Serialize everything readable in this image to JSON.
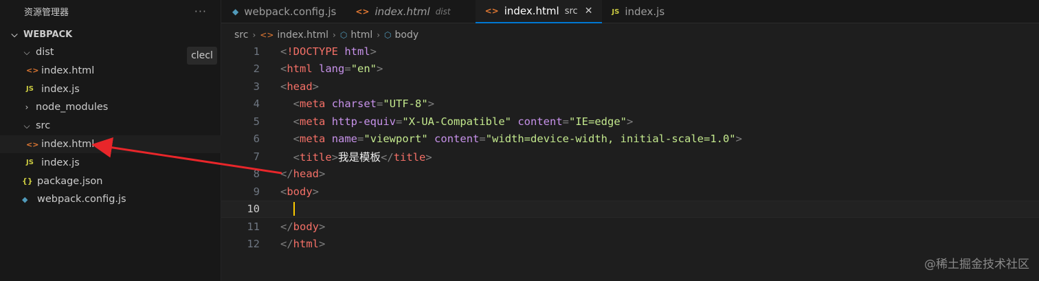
{
  "sidebar": {
    "title": "资源管理器",
    "more": "···",
    "root": "WEBPACK",
    "items": [
      {
        "label": "dist",
        "type": "folder",
        "open": true,
        "depth": 1
      },
      {
        "label": "index.html",
        "type": "html",
        "depth": 2
      },
      {
        "label": "index.js",
        "type": "js",
        "depth": 2
      },
      {
        "label": "node_modules",
        "type": "folder",
        "open": false,
        "depth": 1
      },
      {
        "label": "src",
        "type": "folder",
        "open": true,
        "depth": 1
      },
      {
        "label": "index.html",
        "type": "html",
        "depth": 2,
        "selected": true
      },
      {
        "label": "index.js",
        "type": "js",
        "depth": 2
      },
      {
        "label": "package.json",
        "type": "json",
        "depth": 1
      },
      {
        "label": "webpack.config.js",
        "type": "cube",
        "depth": 1
      }
    ],
    "tooltip": "clecl"
  },
  "tabs": [
    {
      "label": "webpack.config.js",
      "desc": "",
      "icon": "cube-icon",
      "italic": false,
      "active": false
    },
    {
      "label": "index.html",
      "desc": "dist",
      "icon": "html-icon",
      "italic": true,
      "active": false
    },
    {
      "label": "index.html",
      "desc": "src",
      "icon": "html-icon",
      "italic": false,
      "active": true
    },
    {
      "label": "index.js",
      "desc": "",
      "icon": "js-icon",
      "italic": false,
      "active": false
    }
  ],
  "breadcrumb": [
    "src",
    "index.html",
    "html",
    "body"
  ],
  "editor": {
    "current_line": 10,
    "lines": [
      [
        [
          "p",
          "<"
        ],
        [
          "d",
          "!DOCTYPE"
        ],
        [
          "t",
          " "
        ],
        [
          "a",
          "html"
        ],
        [
          "p",
          ">"
        ]
      ],
      [
        [
          "p",
          "<"
        ],
        [
          "g",
          "html"
        ],
        [
          "t",
          " "
        ],
        [
          "a",
          "lang"
        ],
        [
          "p",
          "="
        ],
        [
          "s",
          "\"en\""
        ],
        [
          "p",
          ">"
        ]
      ],
      [
        [
          "p",
          "<"
        ],
        [
          "g",
          "head"
        ],
        [
          "p",
          ">"
        ]
      ],
      [
        [
          "t",
          "  "
        ],
        [
          "p",
          "<"
        ],
        [
          "g",
          "meta"
        ],
        [
          "t",
          " "
        ],
        [
          "a",
          "charset"
        ],
        [
          "p",
          "="
        ],
        [
          "s",
          "\"UTF-8\""
        ],
        [
          "p",
          ">"
        ]
      ],
      [
        [
          "t",
          "  "
        ],
        [
          "p",
          "<"
        ],
        [
          "g",
          "meta"
        ],
        [
          "t",
          " "
        ],
        [
          "a",
          "http-equiv"
        ],
        [
          "p",
          "="
        ],
        [
          "s",
          "\"X-UA-Compatible\""
        ],
        [
          "t",
          " "
        ],
        [
          "a",
          "content"
        ],
        [
          "p",
          "="
        ],
        [
          "s",
          "\"IE=edge\""
        ],
        [
          "p",
          ">"
        ]
      ],
      [
        [
          "t",
          "  "
        ],
        [
          "p",
          "<"
        ],
        [
          "g",
          "meta"
        ],
        [
          "t",
          " "
        ],
        [
          "a",
          "name"
        ],
        [
          "p",
          "="
        ],
        [
          "s",
          "\"viewport\""
        ],
        [
          "t",
          " "
        ],
        [
          "a",
          "content"
        ],
        [
          "p",
          "="
        ],
        [
          "s",
          "\"width=device-width, initial-scale=1.0\""
        ],
        [
          "p",
          ">"
        ]
      ],
      [
        [
          "t",
          "  "
        ],
        [
          "p",
          "<"
        ],
        [
          "g",
          "title"
        ],
        [
          "p",
          ">"
        ],
        [
          "x",
          "我是模板"
        ],
        [
          "p",
          "</"
        ],
        [
          "g",
          "title"
        ],
        [
          "p",
          ">"
        ]
      ],
      [
        [
          "p",
          "</"
        ],
        [
          "g",
          "head"
        ],
        [
          "p",
          ">"
        ]
      ],
      [
        [
          "p",
          "<"
        ],
        [
          "g",
          "body"
        ],
        [
          "p",
          ">"
        ]
      ],
      [
        [
          "t",
          "  "
        ],
        [
          "c",
          ""
        ]
      ],
      [
        [
          "p",
          "</"
        ],
        [
          "g",
          "body"
        ],
        [
          "p",
          ">"
        ]
      ],
      [
        [
          "p",
          "</"
        ],
        [
          "g",
          "html"
        ],
        [
          "p",
          ">"
        ]
      ]
    ]
  },
  "watermark": "@稀土掘金技术社区",
  "colors": {
    "accent": "#0078d4",
    "arrow": "#e8262a",
    "cursor": "#ffcc00"
  }
}
